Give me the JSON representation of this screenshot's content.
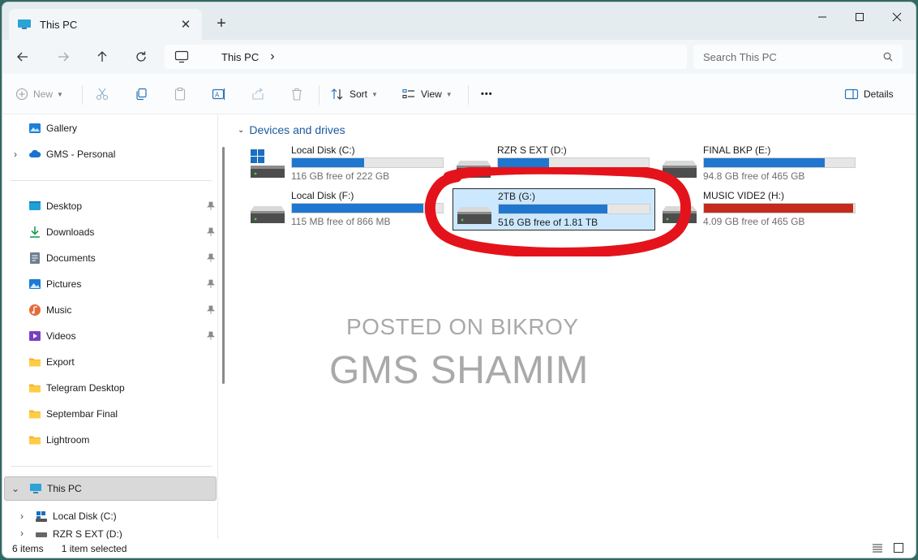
{
  "tab": {
    "title": "This PC",
    "close": "✕",
    "new": "+"
  },
  "window_controls": {
    "minimize": "–",
    "maximize": "☐",
    "close": "✕"
  },
  "address": {
    "location": "This PC",
    "chevron": "›"
  },
  "search": {
    "placeholder": "Search This PC"
  },
  "commands": {
    "new": "New",
    "sort": "Sort",
    "view": "View",
    "more": "•••",
    "details": "Details"
  },
  "sidebar": {
    "quick": [
      {
        "label": "Gallery",
        "icon": "gallery-icon"
      },
      {
        "label": "GMS - Personal",
        "icon": "onedrive-icon"
      }
    ],
    "pinned": [
      {
        "label": "Desktop",
        "icon": "desktop-icon"
      },
      {
        "label": "Downloads",
        "icon": "downloads-icon"
      },
      {
        "label": "Documents",
        "icon": "documents-icon"
      },
      {
        "label": "Pictures",
        "icon": "pictures-icon"
      },
      {
        "label": "Music",
        "icon": "music-icon"
      },
      {
        "label": "Videos",
        "icon": "videos-icon"
      }
    ],
    "folders": [
      {
        "label": "Export"
      },
      {
        "label": "Telegram Desktop"
      },
      {
        "label": "Septembar Final"
      },
      {
        "label": "Lightroom"
      }
    ],
    "this_pc": "This PC",
    "children": [
      {
        "label": "Local Disk (C:)"
      },
      {
        "label": "RZR S EXT (D:)"
      }
    ]
  },
  "main": {
    "group_title": "Devices and drives",
    "drives": [
      {
        "name": "Local Disk (C:)",
        "free": "116 GB free of 222 GB",
        "used_fraction": 0.48,
        "color": "#2077cf",
        "system": true
      },
      {
        "name": "RZR S EXT (D:)",
        "free": "",
        "used_fraction": 0.34,
        "color": "#2077cf"
      },
      {
        "name": "FINAL BKP (E:)",
        "free": "94.8 GB free of 465 GB",
        "used_fraction": 0.8,
        "color": "#2077cf"
      },
      {
        "name": "Local Disk (F:)",
        "free": "115 MB free of 866 MB",
        "used_fraction": 0.87,
        "color": "#2077cf"
      },
      {
        "name": "2TB (G:)",
        "free": "516 GB free of 1.81 TB",
        "used_fraction": 0.72,
        "color": "#2077cf",
        "selected": true
      },
      {
        "name": "MUSIC VIDE2 (H:)",
        "free": "4.09 GB free of 465 GB",
        "used_fraction": 0.99,
        "color": "#c42b1c"
      }
    ],
    "watermark_line1": "POSTED ON BIKROY",
    "watermark_line2": "GMS SHAMIM",
    "highlight_color": "#e4131b"
  },
  "status": {
    "items": "6 items",
    "selected": "1 item selected"
  }
}
